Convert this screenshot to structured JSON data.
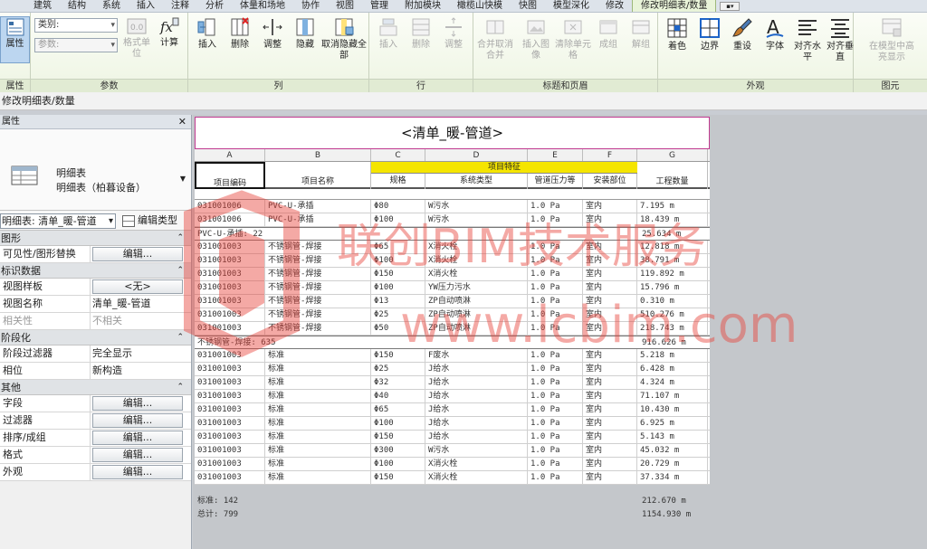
{
  "ribbon_tabs": [
    "建筑",
    "结构",
    "系统",
    "插入",
    "注释",
    "分析",
    "体量和场地",
    "协作",
    "视图",
    "管理",
    "附加模块",
    "橄榄山快模",
    "快图",
    "模型深化",
    "修改",
    "修改明细表/数量"
  ],
  "active_tab": "修改明细表/数量",
  "ribbon": {
    "properties_label": "属性",
    "category_placeholder": "类别:",
    "param_placeholder": "参数:",
    "format_unit_label": "格式单位",
    "calculate_label": "计算",
    "col_insert": "插入",
    "col_delete": "删除",
    "col_resize": "调整",
    "col_hide": "隐藏",
    "col_unhide_all": "取消隐藏全部",
    "row_insert": "插入",
    "row_delete": "删除",
    "row_resize": "调整",
    "merge_unmerge": "合并取消合并",
    "insert_image": "插入图像",
    "clear_cell": "清除单元格",
    "group": "成组",
    "ungroup": "解组",
    "shading": "着色",
    "borders": "边界",
    "reset": "重设",
    "font": "字体",
    "align_h": "对齐水平",
    "align_v": "对齐垂直",
    "highlight_in_model": "在模型中高亮显示",
    "panels": [
      "属性",
      "参数",
      "列",
      "行",
      "标题和页眉",
      "外观",
      "图元"
    ]
  },
  "context_bar": "修改明细表/数量",
  "properties": {
    "title": "属性",
    "type_line1": "明细表",
    "type_line2": "明细表（柏暮设备）",
    "selector_value": "明细表: 清单_暖-管道",
    "edit_type": "编辑类型",
    "groups": [
      {
        "name": "图形",
        "rows": [
          {
            "k": "可见性/图形替换",
            "v": "编辑...",
            "btn": true
          }
        ]
      },
      {
        "name": "标识数据",
        "rows": [
          {
            "k": "视图样板",
            "v": "<无>",
            "btn": true
          },
          {
            "k": "视图名称",
            "v": "清单_暖-管道"
          },
          {
            "k": "相关性",
            "v": "不相关",
            "gray": true
          }
        ]
      },
      {
        "name": "阶段化",
        "rows": [
          {
            "k": "阶段过滤器",
            "v": "完全显示"
          },
          {
            "k": "相位",
            "v": "新构造"
          }
        ]
      },
      {
        "name": "其他",
        "rows": [
          {
            "k": "字段",
            "v": "编辑...",
            "btn": true
          },
          {
            "k": "过滤器",
            "v": "编辑...",
            "btn": true
          },
          {
            "k": "排序/成组",
            "v": "编辑...",
            "btn": true
          },
          {
            "k": "格式",
            "v": "编辑...",
            "btn": true
          },
          {
            "k": "外观",
            "v": "编辑...",
            "btn": true
          }
        ]
      }
    ]
  },
  "schedule": {
    "title": "<清单_暖-管道>",
    "column_letters": [
      "A",
      "B",
      "C",
      "D",
      "E",
      "F",
      "G"
    ],
    "group_header": "项目特征",
    "headers": [
      "项目编码",
      "项目名称",
      "规格",
      "系统类型",
      "管道压力等",
      "安装部位",
      "工程数量"
    ],
    "rows": [
      [
        "031001006",
        "PVC-U-承插",
        "Φ80",
        "W污水",
        "1.0 Pa",
        "室内",
        "7.195 m"
      ],
      [
        "031001006",
        "PVC-U-承插",
        "Φ100",
        "W污水",
        "1.0 Pa",
        "室内",
        "18.439 m"
      ],
      {
        "sum": "PVC-U-承插: 22",
        "total": "25.634 m"
      },
      [
        "031001003",
        "不锈钢管-焊接",
        "Φ65",
        "X消火栓",
        "1.0 Pa",
        "室内",
        "12.818 m"
      ],
      [
        "031001003",
        "不锈钢管-焊接",
        "Φ100",
        "X消火栓",
        "1.0 Pa",
        "室内",
        "38.791 m"
      ],
      [
        "031001003",
        "不锈钢管-焊接",
        "Φ150",
        "X消火栓",
        "1.0 Pa",
        "室内",
        "119.892 m"
      ],
      [
        "031001003",
        "不锈钢管-焊接",
        "Φ100",
        "YW压力污水",
        "1.0 Pa",
        "室内",
        "15.796 m"
      ],
      [
        "031001003",
        "不锈钢管-焊接",
        "Φ13",
        "ZP自动喷淋",
        "1.0 Pa",
        "室内",
        "0.310 m"
      ],
      [
        "031001003",
        "不锈钢管-焊接",
        "Φ25",
        "ZP自动喷淋",
        "1.0 Pa",
        "室内",
        "510.276 m"
      ],
      [
        "031001003",
        "不锈钢管-焊接",
        "Φ50",
        "ZP自动喷淋",
        "1.0 Pa",
        "室内",
        "218.743 m"
      ],
      {
        "sum": "不锈钢管-焊接: 635",
        "total": "916.626 m"
      },
      [
        "031001003",
        "标准",
        "Φ150",
        "F废水",
        "1.0 Pa",
        "室内",
        "5.218 m"
      ],
      [
        "031001003",
        "标准",
        "Φ25",
        "J给水",
        "1.0 Pa",
        "室内",
        "6.428 m"
      ],
      [
        "031001003",
        "标准",
        "Φ32",
        "J给水",
        "1.0 Pa",
        "室内",
        "4.324 m"
      ],
      [
        "031001003",
        "标准",
        "Φ40",
        "J给水",
        "1.0 Pa",
        "室内",
        "71.107 m"
      ],
      [
        "031001003",
        "标准",
        "Φ65",
        "J给水",
        "1.0 Pa",
        "室内",
        "10.430 m"
      ],
      [
        "031001003",
        "标准",
        "Φ100",
        "J给水",
        "1.0 Pa",
        "室内",
        "6.925 m"
      ],
      [
        "031001003",
        "标准",
        "Φ150",
        "J给水",
        "1.0 Pa",
        "室内",
        "5.143 m"
      ],
      [
        "031001003",
        "标准",
        "Φ300",
        "W污水",
        "1.0 Pa",
        "室内",
        "45.032 m"
      ],
      [
        "031001003",
        "标准",
        "Φ100",
        "X消火栓",
        "1.0 Pa",
        "室内",
        "20.729 m"
      ],
      [
        "031001003",
        "标准",
        "Φ150",
        "X消火栓",
        "1.0 Pa",
        "室内",
        "37.334 m"
      ]
    ],
    "footer": [
      {
        "label": "标准: 142",
        "total": "212.670 m"
      },
      {
        "label": "总计: 799",
        "total": "1154.930 m"
      }
    ]
  },
  "watermark": {
    "line1": "联创BIM技术服务",
    "line2": "www.lcbim.com",
    "color": "#e8433a"
  }
}
